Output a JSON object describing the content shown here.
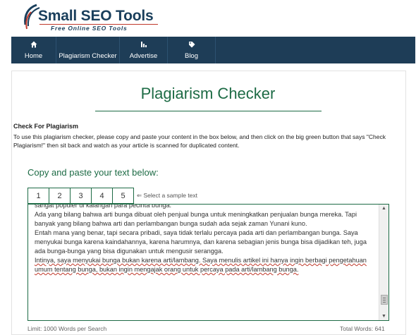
{
  "brand": {
    "name_part1": "Small ",
    "name_part2": "SEO Tools",
    "tagline": "Free Online SEO Tools"
  },
  "nav": {
    "items": [
      {
        "label": "Home",
        "icon": "home-icon"
      },
      {
        "label": "Plagiarism Checker",
        "icon": "plagiarism-checker-icon"
      },
      {
        "label": "Advertise",
        "icon": "advertise-icon"
      },
      {
        "label": "Blog",
        "icon": "tag-icon"
      }
    ]
  },
  "main": {
    "title": "Plagiarism Checker",
    "section_heading": "Check For Plagiarism",
    "intro": "To use this plagiarism checker, please copy and paste your content in the box below, and then click on the big green button that says \"Check Plagiarism!\" then sit back and watch as your article is scanned for duplicated content.",
    "copy_label": "Copy and paste your text below:",
    "samples": [
      "1",
      "2",
      "3",
      "4",
      "5"
    ],
    "sample_hint": "⇐ Select a sample text",
    "textarea_lines": [
      "sangat populer di kalangan para pecinta bunga.",
      "Ada yang bilang bahwa arti bunga dibuat oleh penjual bunga untuk meningkatkan penjualan bunga mereka. Tapi banyak yang bilang bahwa arti dan perlambangan bunga sudah ada sejak zaman Yunani kuno.",
      "Entah mana yang benar, tapi secara pribadi, saya tidak terlalu percaya pada arti dan perlambangan bunga. Saya menyukai bunga karena kaindahannya, karena harumnya, dan karena sebagian jenis bunga bisa dijadikan teh, juga ada bunga-bunga yang bisa digunakan untuk mengusir serangga.",
      "Intinya, saya menyukai bunga bukan karena arti/lambang. Saya menulis artikel ini hanya ingin berbagi pengetahuan umum tentang bunga, bukan ingin mengajak orang untuk percaya pada arti/lambang bunga."
    ],
    "limit_text": "Limit: 1000 Words per Search",
    "total_words": "Total Words: 641"
  },
  "colors": {
    "brand_navy": "#1e3d57",
    "accent_green": "#1d6b45"
  }
}
